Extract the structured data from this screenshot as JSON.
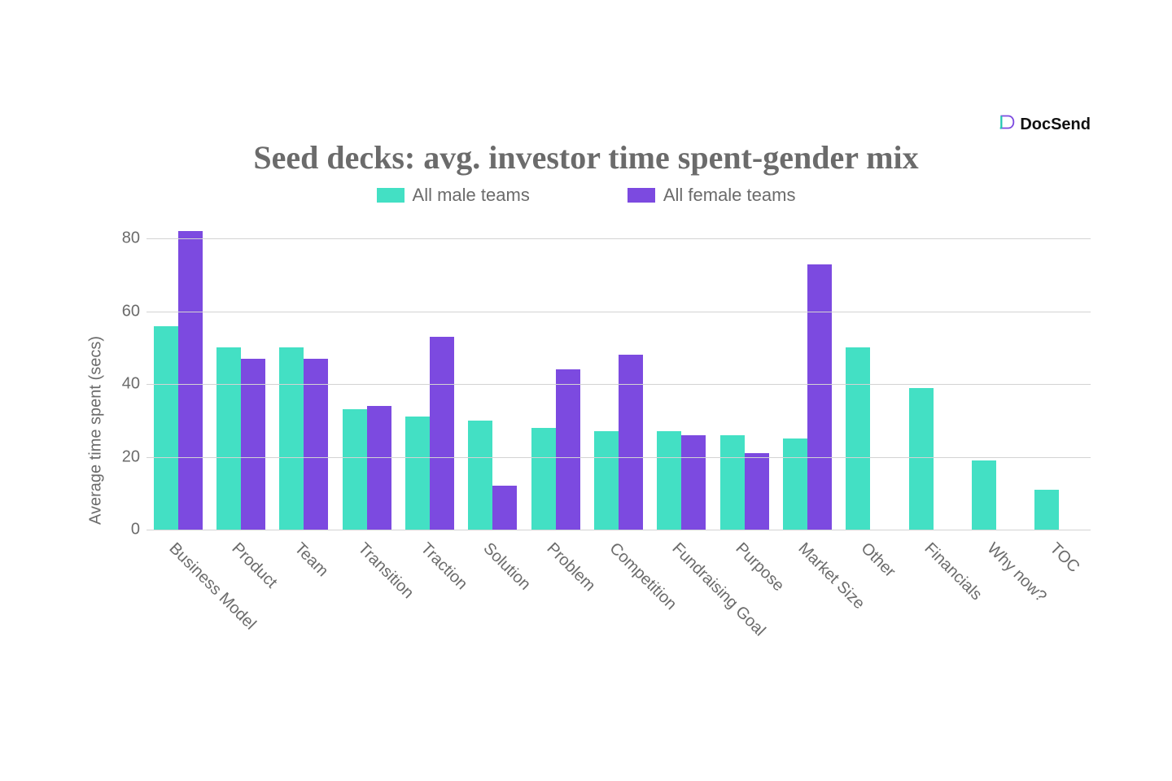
{
  "brand": {
    "name": "DocSend"
  },
  "chart_data": {
    "type": "bar",
    "title": "Seed decks: avg. investor time spent-gender mix",
    "ylabel": "Average time spent (secs)",
    "xlabel": "",
    "ylim": [
      0,
      85
    ],
    "yticks": [
      0,
      20,
      40,
      60,
      80
    ],
    "legend_position": "top",
    "grid": true,
    "categories": [
      "Business Model",
      "Product",
      "Team",
      "Transition",
      "Traction",
      "Solution",
      "Problem",
      "Competition",
      "Fundraising Goal",
      "Purpose",
      "Market Size",
      "Other",
      "Financials",
      "Why now?",
      "TOC"
    ],
    "series": [
      {
        "name": "All male teams",
        "color": "#43e0c4",
        "values": [
          56,
          50,
          50,
          33,
          31,
          30,
          28,
          27,
          27,
          26,
          25,
          50,
          39,
          19,
          11
        ]
      },
      {
        "name": "All female teams",
        "color": "#7c4ae0",
        "values": [
          82,
          47,
          47,
          34,
          53,
          12,
          44,
          48,
          26,
          21,
          73,
          null,
          null,
          null,
          null
        ]
      }
    ]
  }
}
